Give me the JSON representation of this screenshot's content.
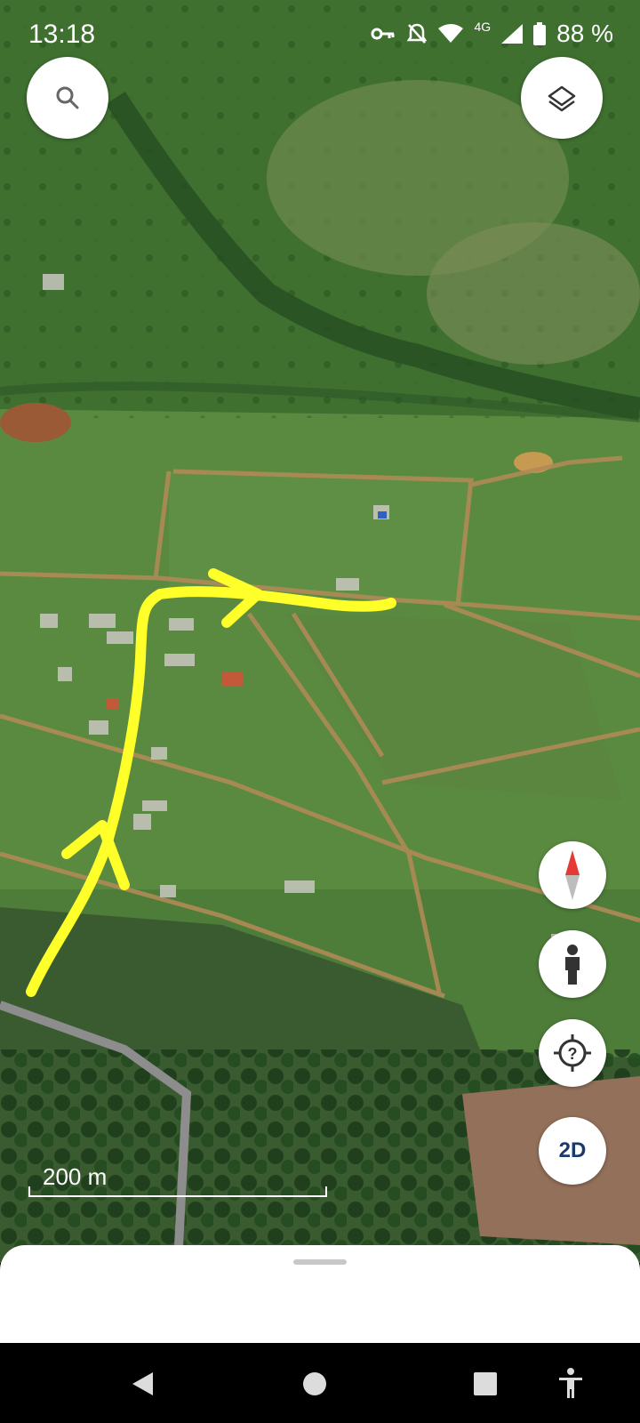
{
  "status_bar": {
    "time": "13:18",
    "network": "4G",
    "battery": "88 %",
    "icons": [
      "key-icon",
      "bell-off-icon",
      "wifi-icon",
      "signal-icon",
      "battery-icon"
    ]
  },
  "map": {
    "type": "satellite",
    "scale_label": "200 m",
    "annotation_color": "#ffff2a"
  },
  "controls": {
    "search_icon": "search-icon",
    "layers_icon": "layers-icon",
    "compass_icon": "compass-icon",
    "street_view_icon": "pegman-icon",
    "location_help_icon": "location-help-icon",
    "view_mode_label": "2D"
  },
  "nav_bar": {
    "items": [
      "back-icon",
      "home-icon",
      "recents-icon",
      "accessibility-icon"
    ]
  }
}
